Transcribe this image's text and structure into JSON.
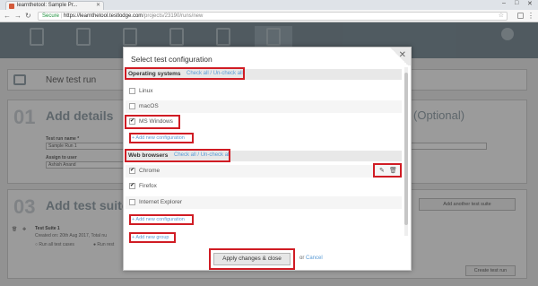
{
  "browser": {
    "tab_title": "learnthetool: Sample Pr...",
    "secure_label": "Secure",
    "url_host": "https://learnthetool.testlodge.com",
    "url_path": "/projects/23190/runs/new"
  },
  "page": {
    "title": "New test run",
    "sec1_num": "01",
    "sec1_title": "Add details",
    "optional_label": "(Optional)",
    "run_name_label": "Test run name *",
    "run_name_value": "Sample Run 1",
    "assign_label": "Assign to user",
    "assign_value": "Ashish Anand",
    "sec3_num": "03",
    "sec3_title": "Add test suite",
    "add_another_label": "Add another test suite",
    "suite_name": "Test Suite 1",
    "suite_meta": "Created on: 20th Aug 2017, Total nu",
    "run_all_label": "Run all test cases",
    "run_rest_label": "Run rest",
    "create_run_label": "Create test run"
  },
  "modal": {
    "title": "Select test configuration",
    "close_glyph": "✕",
    "os": {
      "heading": "Operating systems",
      "check_all": "Check all",
      "sep": "/",
      "uncheck_all": "Un-check all",
      "items": [
        {
          "label": "Linux",
          "checked": ""
        },
        {
          "label": "macOS",
          "checked": ""
        },
        {
          "label": "MS Windows",
          "checked": "✔"
        }
      ],
      "add_new": "+ Add new configuration"
    },
    "browsers": {
      "heading": "Web browsers",
      "check_all": "Check all",
      "sep": "/",
      "uncheck_all": "Un-check all",
      "items": [
        {
          "label": "Chrome",
          "checked": "✔"
        },
        {
          "label": "Firefox",
          "checked": "✔"
        },
        {
          "label": "Internet Explorer",
          "checked": ""
        }
      ],
      "add_new": "+ Add new configuration",
      "edit_icon": "✎",
      "delete_icon": "🗑"
    },
    "add_group": "+ Add new group",
    "apply_label": "Apply changes & close",
    "or_text": "or",
    "cancel_label": "Cancel"
  },
  "colors": {
    "accent_link": "#5a9bd5",
    "highlight": "#d01c24"
  }
}
